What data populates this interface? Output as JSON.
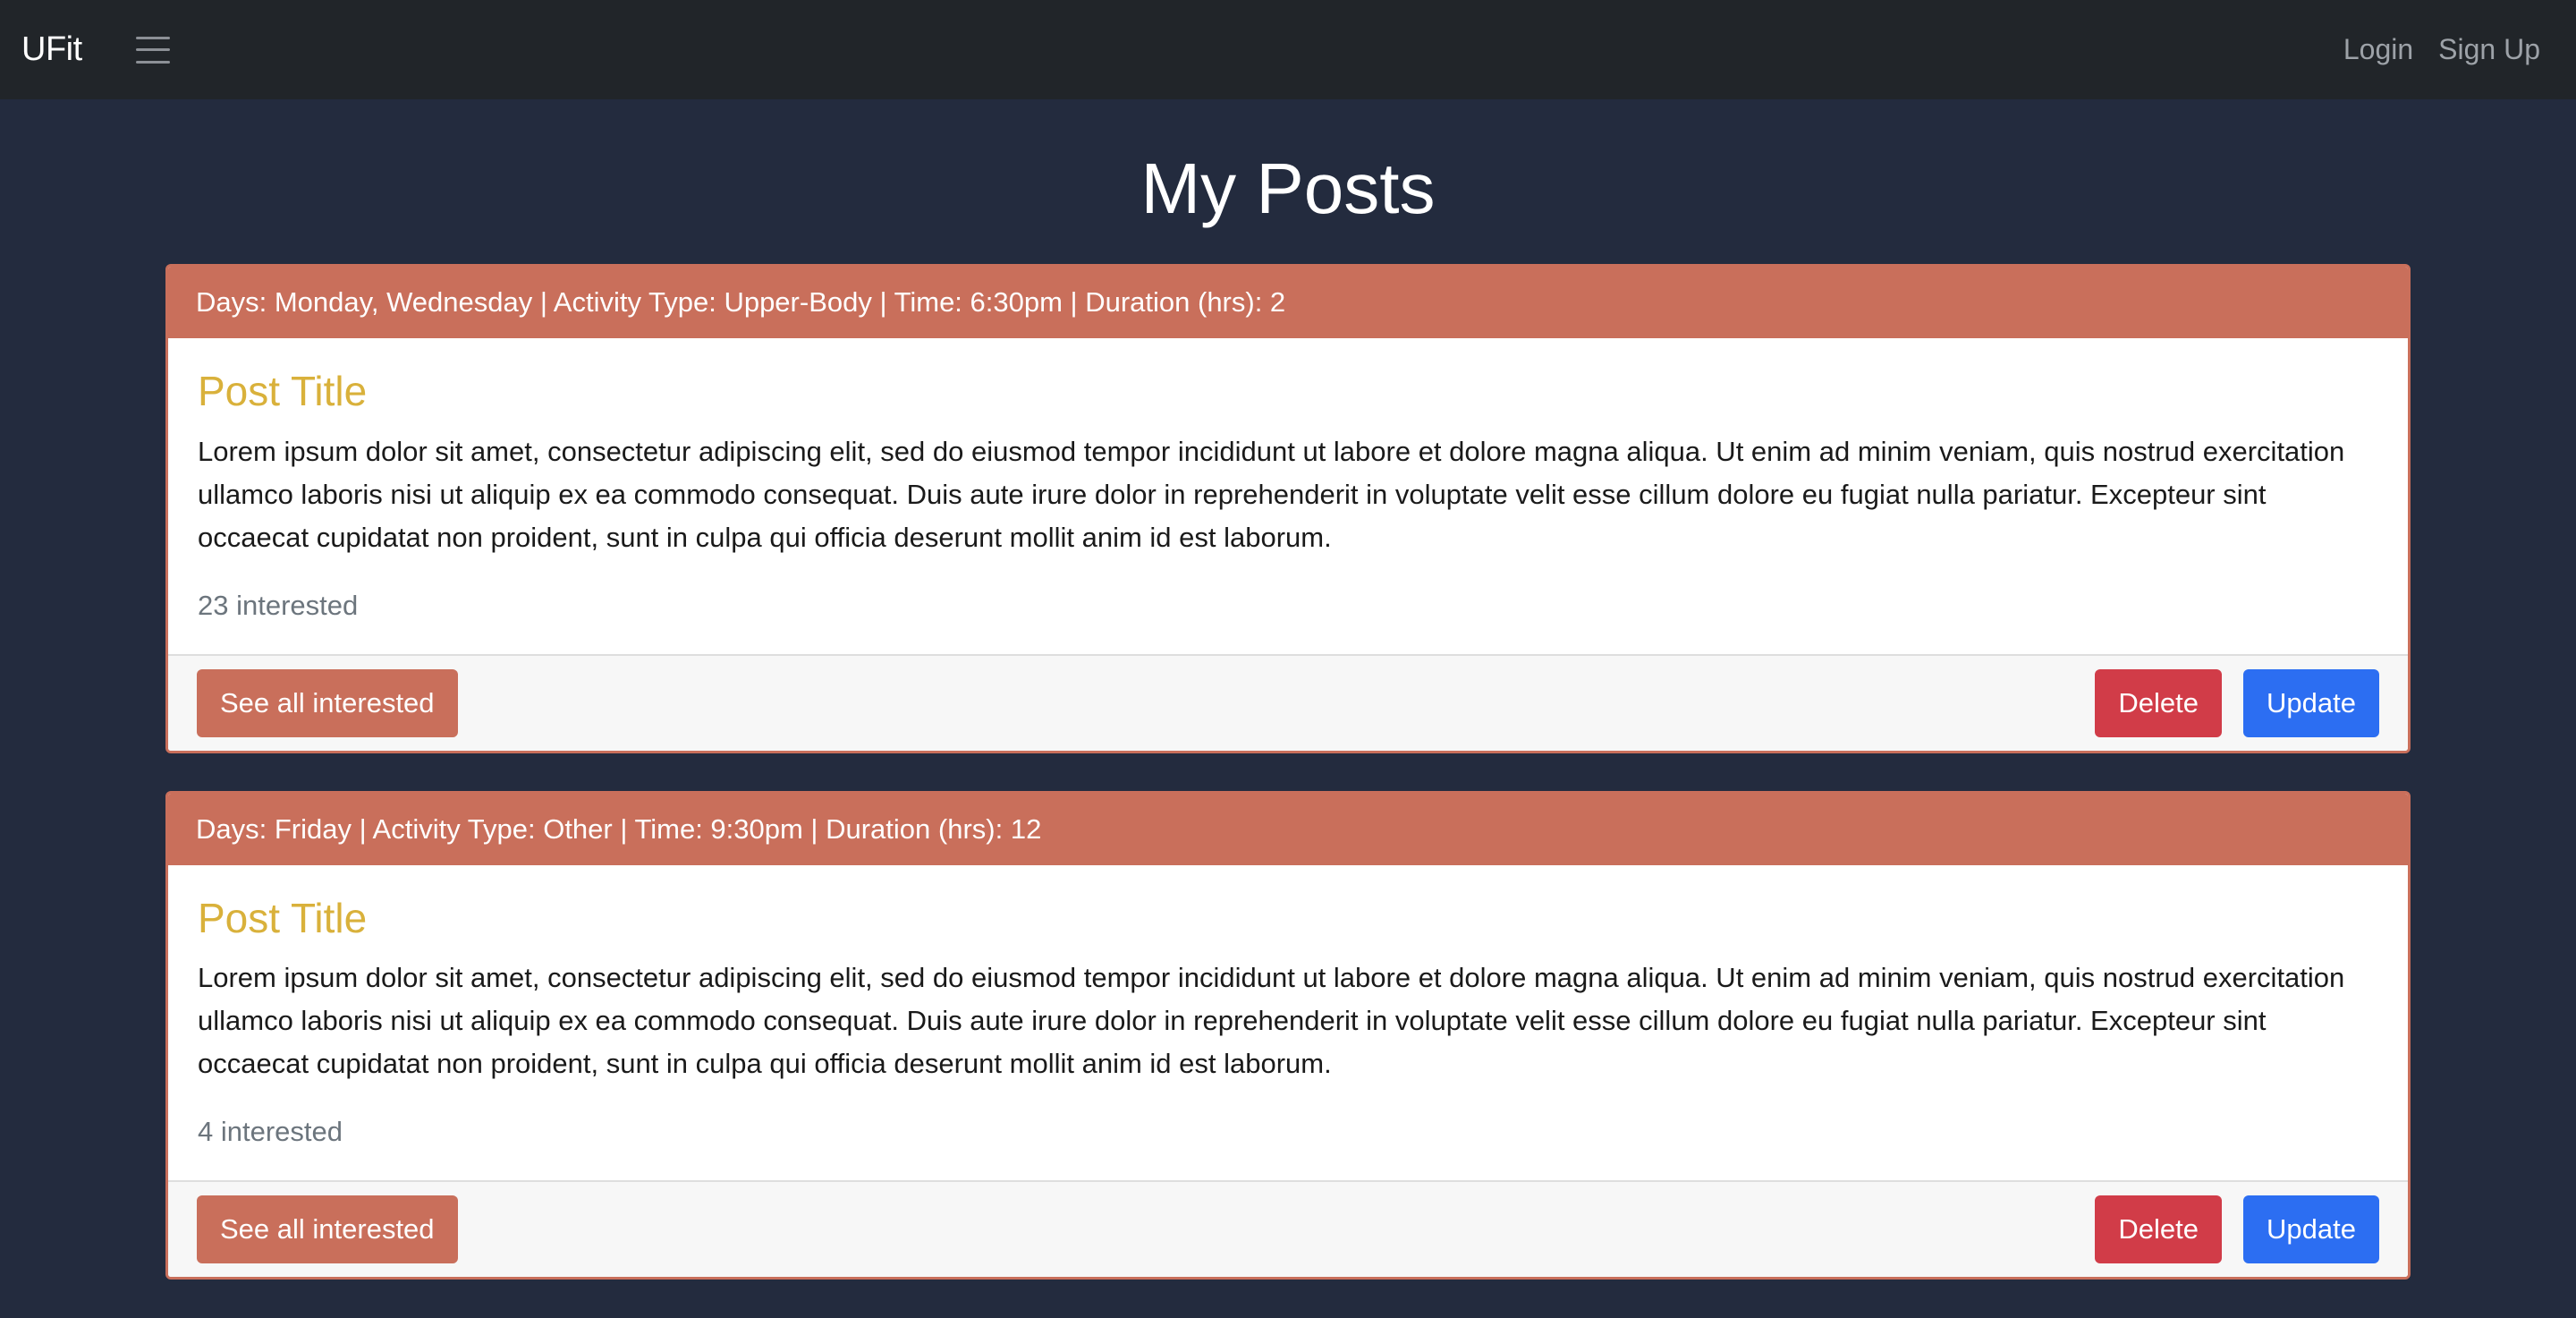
{
  "nav": {
    "brand": "UFit",
    "login": "Login",
    "signup": "Sign Up"
  },
  "page": {
    "title": "My Posts"
  },
  "posts": [
    {
      "header": "Days: Monday, Wednesday | Activity Type: Upper-Body | Time: 6:30pm | Duration (hrs): 2",
      "title": "Post Title",
      "body": "Lorem ipsum dolor sit amet, consectetur adipiscing elit, sed do eiusmod tempor incididunt ut labore et dolore magna aliqua. Ut enim ad minim veniam, quis nostrud exercitation ullamco laboris nisi ut aliquip ex ea commodo consequat. Duis aute irure dolor in reprehenderit in voluptate velit esse cillum dolore eu fugiat nulla pariatur. Excepteur sint occaecat cupidatat non proident, sunt in culpa qui officia deserunt mollit anim id est laborum.",
      "interested": "23 interested",
      "see_all_label": "See all interested",
      "delete_label": "Delete",
      "update_label": "Update"
    },
    {
      "header": "Days: Friday | Activity Type: Other | Time: 9:30pm | Duration (hrs): 12",
      "title": "Post Title",
      "body": "Lorem ipsum dolor sit amet, consectetur adipiscing elit, sed do eiusmod tempor incididunt ut labore et dolore magna aliqua. Ut enim ad minim veniam, quis nostrud exercitation ullamco laboris nisi ut aliquip ex ea commodo consequat. Duis aute irure dolor in reprehenderit in voluptate velit esse cillum dolore eu fugiat nulla pariatur. Excepteur sint occaecat cupidatat non proident, sunt in culpa qui officia deserunt mollit anim id est laborum.",
      "interested": "4 interested",
      "see_all_label": "See all interested",
      "delete_label": "Delete",
      "update_label": "Update"
    }
  ],
  "icons": {
    "menu": "hamburger-menu-icon"
  },
  "colors": {
    "navbar_bg": "#212529",
    "page_bg": "#232b3e",
    "card_accent": "#c96f5b",
    "title_gold": "#d9b13b",
    "delete_red": "#d13c48",
    "update_blue": "#2c6ef2"
  }
}
